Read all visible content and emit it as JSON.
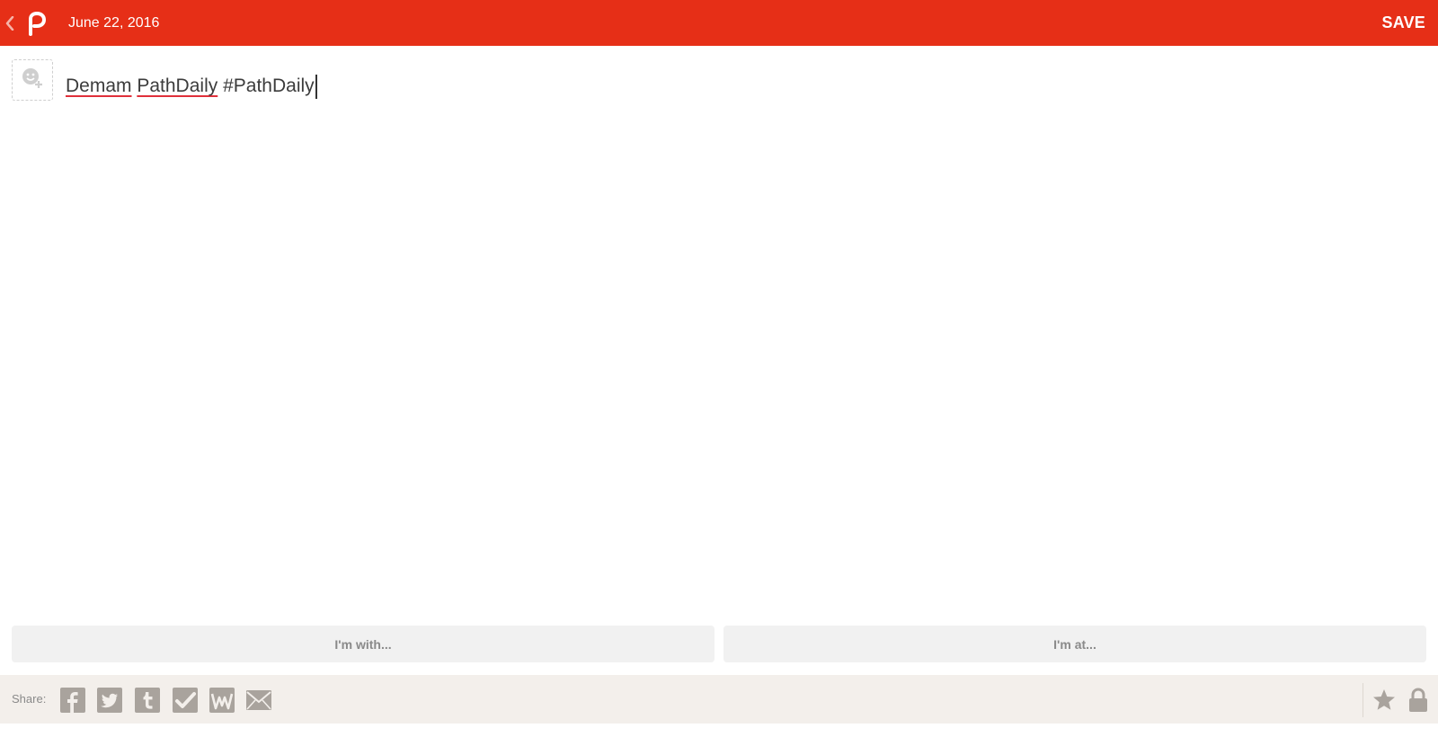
{
  "header": {
    "date": "June 22, 2016",
    "save_label": "SAVE",
    "back_icon": "chevron-left-icon",
    "logo_icon": "path-logo-icon",
    "color": "#e62f17"
  },
  "composer": {
    "emotion_icon": "smiley-add-icon",
    "text_words": [
      "Demam",
      "PathDaily",
      "#PathDaily"
    ]
  },
  "context": {
    "with_label": "I'm with...",
    "at_label": "I'm at..."
  },
  "share": {
    "label": "Share:",
    "services": [
      "facebook",
      "twitter",
      "tumblr",
      "foursquare",
      "wordpress",
      "email"
    ],
    "right_icons": [
      "star-icon",
      "lock-icon"
    ]
  }
}
